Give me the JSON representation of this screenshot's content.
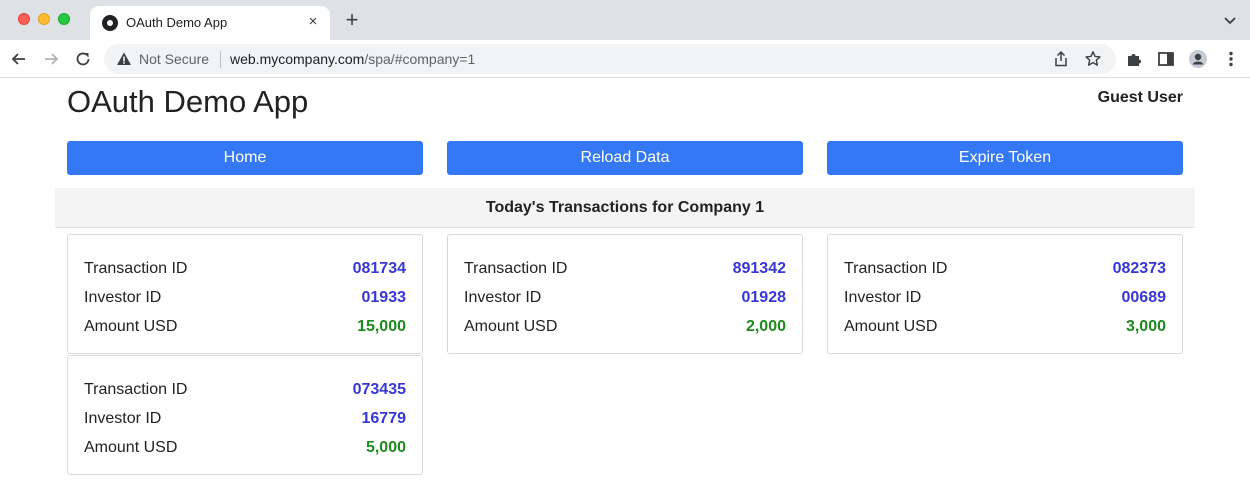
{
  "browser": {
    "tab_title": "OAuth Demo App",
    "tab_close": "×",
    "new_tab": "+",
    "security_text": "Not Secure",
    "url_host": "web.mycompany.com",
    "url_path": "/spa/#company=1"
  },
  "app": {
    "title": "OAuth Demo App",
    "user": "Guest User"
  },
  "buttons": {
    "home": "Home",
    "reload": "Reload Data",
    "expire": "Expire Token"
  },
  "heading": "Today's Transactions for Company 1",
  "labels": {
    "transaction_id": "Transaction ID",
    "investor_id": "Investor ID",
    "amount": "Amount USD"
  },
  "colors": {
    "button": "#3478f6",
    "id_value": "#3737d8",
    "amount_value": "#1d8a1d"
  },
  "transactions": [
    {
      "transaction_id": "081734",
      "investor_id": "01933",
      "amount": "15,000"
    },
    {
      "transaction_id": "891342",
      "investor_id": "01928",
      "amount": "2,000"
    },
    {
      "transaction_id": "082373",
      "investor_id": "00689",
      "amount": "3,000"
    },
    {
      "transaction_id": "073435",
      "investor_id": "16779",
      "amount": "5,000"
    }
  ]
}
